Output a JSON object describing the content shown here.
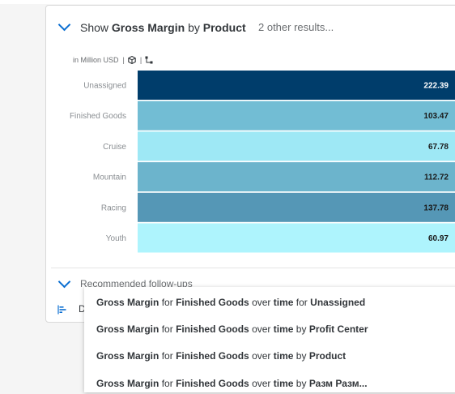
{
  "header": {
    "prefix": "Show",
    "measure": "Gross Margin",
    "by_word": "by",
    "dimension": "Product",
    "other_results": "2 other results..."
  },
  "unit_row": {
    "unit_text": "in Million USD",
    "separator": "|",
    "icons": [
      "cube-icon",
      "hierarchy-icon"
    ]
  },
  "chart_data": {
    "type": "bar",
    "orientation": "horizontal",
    "categories": [
      "Unassigned",
      "Finished Goods",
      "Cruise",
      "Mountain",
      "Racing",
      "Youth"
    ],
    "values": [
      222.39,
      103.47,
      67.78,
      112.72,
      137.78,
      60.97
    ],
    "value_labels": [
      "222.39",
      "103.47",
      "67.78",
      "112.72",
      "137.78",
      "60.97"
    ],
    "colors": [
      "#003d6b",
      "#72bdd4",
      "#9ee8f5",
      "#6cb4cc",
      "#5597b6",
      "#aef4fd"
    ],
    "label_colors": [
      "#ffffff",
      "#1a1a1a",
      "#1a1a1a",
      "#1a1a1a",
      "#1a1a1a",
      "#1a1a1a"
    ],
    "title": "",
    "xlabel": "",
    "ylabel": "",
    "unit": "in Million USD",
    "grid": false,
    "legend": "none"
  },
  "follow_ups": {
    "label": "Recommended follow-ups",
    "partial_label": "D",
    "items": [
      {
        "measure": "Gross Margin",
        "for1": "for",
        "member": "Finished Goods",
        "over": "over",
        "time": "time",
        "conj": "for",
        "target": "Unassigned"
      },
      {
        "measure": "Gross Margin",
        "for1": "for",
        "member": "Finished Goods",
        "over": "over",
        "time": "time",
        "conj": "by",
        "target": "Profit Center"
      },
      {
        "measure": "Gross Margin",
        "for1": "for",
        "member": "Finished Goods",
        "over": "over",
        "time": "time",
        "conj": "by",
        "target": "Product"
      },
      {
        "measure": "Gross Margin",
        "for1": "for",
        "member": "Finished Goods",
        "over": "over",
        "time": "time",
        "conj": "by",
        "target": "Разм Разм..."
      }
    ]
  },
  "colors": {
    "accent": "#0a6ed1",
    "text": "#32363a",
    "muted": "#6a6d70"
  }
}
